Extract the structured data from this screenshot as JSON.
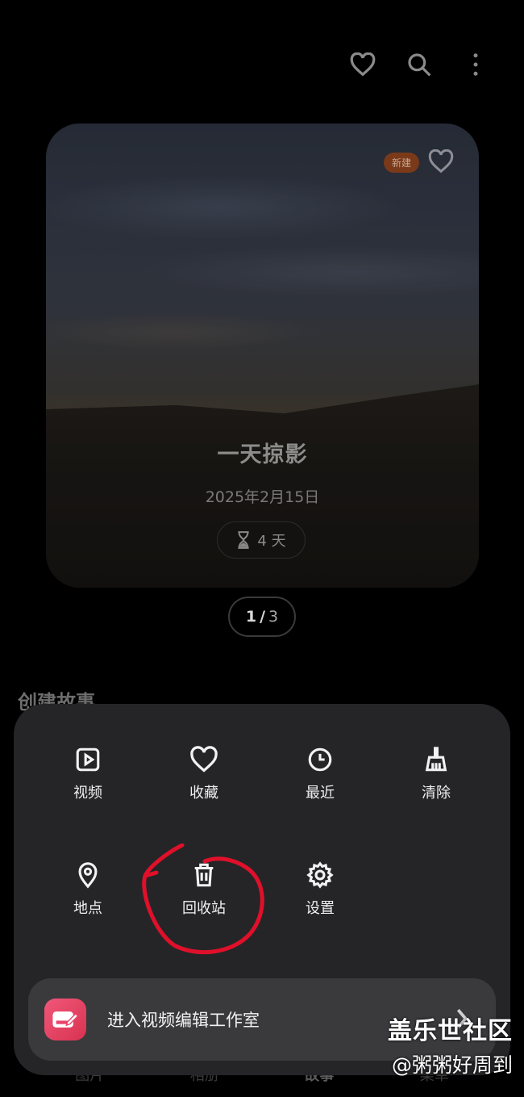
{
  "header": {
    "icons": [
      "heart-icon",
      "search-icon",
      "more-vert-icon"
    ]
  },
  "story": {
    "badge": "新建",
    "title": "一天掠影",
    "date": "2025年2月15日",
    "duration": "4 天",
    "pager_current": "1",
    "pager_sep": "/",
    "pager_total": "3"
  },
  "section": {
    "title": "创建故事"
  },
  "menu": {
    "items": [
      {
        "label": "视频",
        "icon": "video-icon"
      },
      {
        "label": "收藏",
        "icon": "heart-icon"
      },
      {
        "label": "最近",
        "icon": "clock-icon"
      },
      {
        "label": "清除",
        "icon": "broom-icon"
      },
      {
        "label": "地点",
        "icon": "location-pin-icon"
      },
      {
        "label": "回收站",
        "icon": "trash-icon"
      },
      {
        "label": "设置",
        "icon": "gear-icon"
      }
    ],
    "studio_label": "进入视频编辑工作室"
  },
  "bottom_tabs": [
    "图片",
    "相册",
    "故事",
    "菜单"
  ],
  "watermark": {
    "line1": "盖乐世社区",
    "line2": "@粥粥好周到"
  },
  "colors": {
    "background": "#000000",
    "panel": "#252528",
    "annotation_red": "#e0102a",
    "studio_accent": "#e8456a"
  }
}
